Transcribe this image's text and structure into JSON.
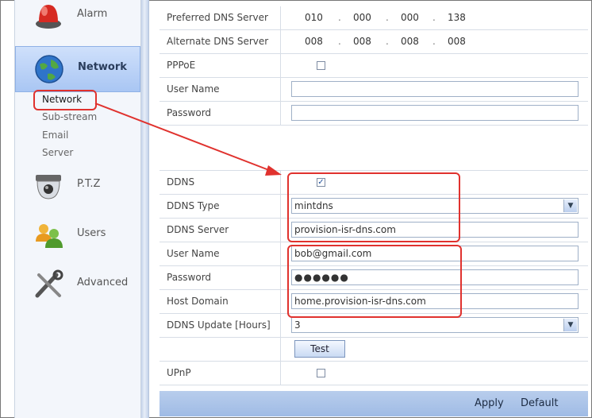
{
  "sidebar": {
    "items": [
      {
        "label": "Alarm",
        "icon": "alarm-icon"
      },
      {
        "label": "Network",
        "icon": "globe-icon"
      },
      {
        "label": "P.T.Z",
        "icon": "dome-camera-icon"
      },
      {
        "label": "Users",
        "icon": "users-icon"
      },
      {
        "label": "Advanced",
        "icon": "tools-icon"
      }
    ],
    "submenu": [
      "Network",
      "Sub-stream",
      "Email",
      "Server"
    ]
  },
  "form": {
    "preferred_dns": {
      "label": "Preferred DNS Server",
      "octets": [
        "010",
        "000",
        "000",
        "138"
      ]
    },
    "alternate_dns": {
      "label": "Alternate DNS Server",
      "octets": [
        "008",
        "008",
        "008",
        "008"
      ]
    },
    "pppoe": {
      "label": "PPPoE",
      "checked": false
    },
    "pppoe_user": {
      "label": "User Name",
      "value": ""
    },
    "pppoe_password": {
      "label": "Password",
      "value": ""
    },
    "ddns": {
      "label": "DDNS",
      "checked": true
    },
    "ddns_type": {
      "label": "DDNS Type",
      "value": "mintdns"
    },
    "ddns_server": {
      "label": "DDNS Server",
      "value": "provision-isr-dns.com"
    },
    "ddns_user": {
      "label": "User Name",
      "value": "bob@gmail.com"
    },
    "ddns_password": {
      "label": "Password",
      "value": "●●●●●●"
    },
    "host_domain": {
      "label": "Host Domain",
      "value": "home.provision-isr-dns.com"
    },
    "ddns_update": {
      "label": "DDNS Update [Hours]",
      "value": "3"
    },
    "test_label": "Test",
    "upnp": {
      "label": "UPnP",
      "checked": false
    }
  },
  "footer": {
    "apply_label": "Apply",
    "default_label": "Default"
  },
  "colors": {
    "highlight": "#e0322e",
    "accent": "#a9c6f3",
    "bar": "#9fbbe5"
  }
}
